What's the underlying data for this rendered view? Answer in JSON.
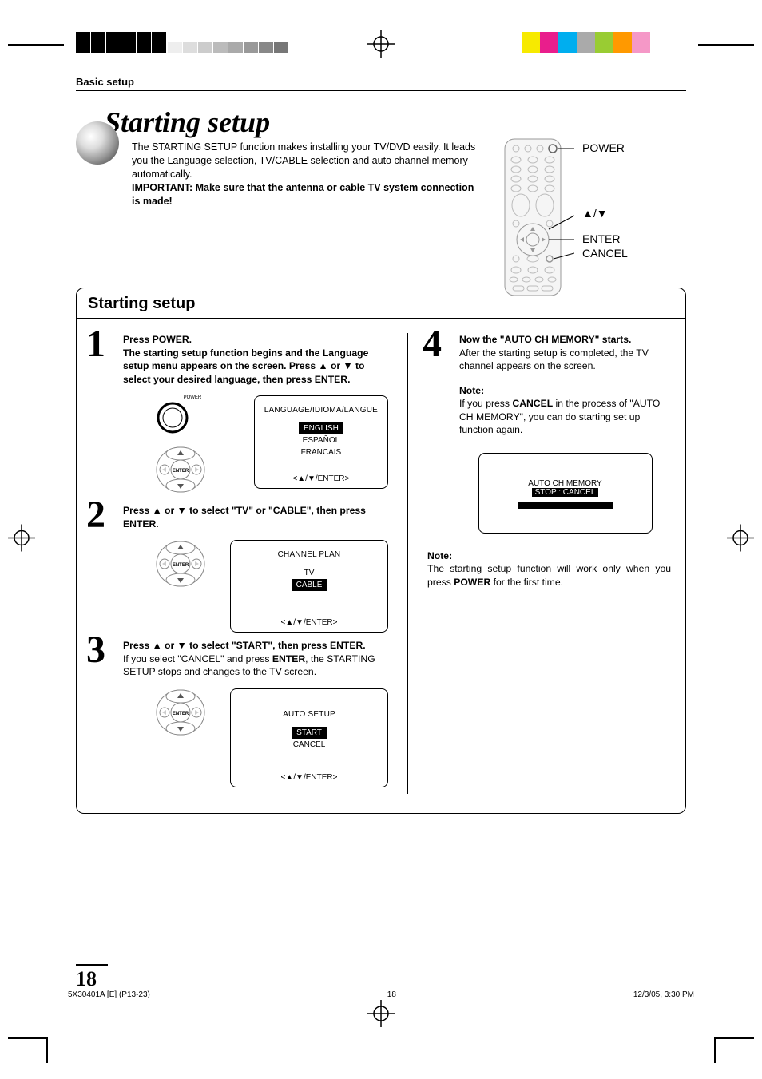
{
  "header": {
    "section": "Basic setup"
  },
  "hero": {
    "title": "Starting setup",
    "body": "The STARTING SETUP function makes installing your TV/DVD easily. It leads you the Language selection, TV/CABLE selection and auto channel memory automatically.",
    "important": "IMPORTANT: Make sure that the antenna or cable TV system connection is made!"
  },
  "remote": {
    "labels": {
      "power": "POWER",
      "updown": "▲/▼",
      "enter": "ENTER",
      "cancel": "CANCEL"
    }
  },
  "panel": {
    "title": "Starting setup"
  },
  "steps": {
    "s1": {
      "num": "1",
      "head": "Press POWER.",
      "body": "The starting setup function begins and the Language setup menu appears on the screen. Press ▲ or ▼ to select your desired language, then press ENTER.",
      "powerLabel": "POWER",
      "osd": {
        "title": "LANGUAGE/IDIOMA/LANGUE",
        "opt1": "ENGLISH",
        "opt2": "ESPAÑOL",
        "opt3": "FRANCAIS",
        "foot": "<▲/▼/ENTER>"
      }
    },
    "s2": {
      "num": "2",
      "head": "Press ▲ or ▼ to select \"TV\" or \"CABLE\", then press ENTER.",
      "osd": {
        "title": "CHANNEL PLAN",
        "opt1": "TV",
        "opt2": "CABLE",
        "foot": "<▲/▼/ENTER>"
      }
    },
    "s3": {
      "num": "3",
      "head": "Press ▲ or ▼ to select \"START\", then press ENTER.",
      "body_pre": "If you select \"CANCEL\" and press ",
      "body_bold": "ENTER",
      "body_post": ", the STARTING SETUP stops and changes to the TV screen.",
      "osd": {
        "title": "AUTO SETUP",
        "opt1": "START",
        "opt2": "CANCEL",
        "foot": "<▲/▼/ENTER>"
      }
    },
    "s4": {
      "num": "4",
      "head": "Now the \"AUTO CH MEMORY\" starts.",
      "body": "After the starting setup is completed, the TV channel appears on the screen.",
      "noteLabel": "Note:",
      "note_pre": "If you press ",
      "note_bold": "CANCEL",
      "note_post": " in the process of \"AUTO CH MEMORY\", you can do starting set up function again.",
      "osd": {
        "line1": "AUTO CH MEMORY",
        "line2": "STOP : CANCEL"
      }
    }
  },
  "outerNote": {
    "label": "Note:",
    "pre": "The starting setup function will work only when you press ",
    "bold": "POWER",
    "post": " for the first time."
  },
  "footer": {
    "pageNum": "18",
    "left": "5X30401A [E] (P13-23)",
    "center": "18",
    "right": "12/3/05, 3:30 PM"
  },
  "colors": {
    "bar": [
      "#f7ea00",
      "#e91e8c",
      "#00aeef",
      "#aaa",
      "#99cc33",
      "#ff9900",
      "#f598c7"
    ],
    "grays": [
      "#eee",
      "#ddd",
      "#ccc",
      "#bbb",
      "#aaa",
      "#999",
      "#888",
      "#777"
    ]
  }
}
